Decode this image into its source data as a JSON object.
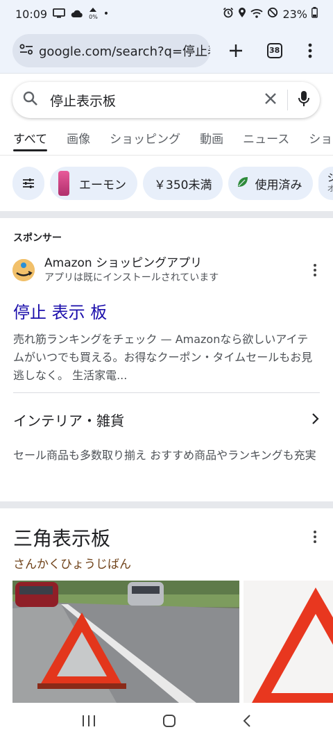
{
  "status": {
    "time": "10:09",
    "battery": "23%",
    "pct_small": "0%"
  },
  "url_bar": {
    "url": "google.com/search?q=停止表",
    "tab_count": "38"
  },
  "search": {
    "query": "停止表示板"
  },
  "tabs": [
    {
      "label": "すべて",
      "active": true
    },
    {
      "label": "画像"
    },
    {
      "label": "ショッピング"
    },
    {
      "label": "動画"
    },
    {
      "label": "ニュース"
    },
    {
      "label": "ショ"
    }
  ],
  "chips": [
    {
      "label": "エーモン"
    },
    {
      "label": "￥350未満"
    },
    {
      "label": "使用済み"
    },
    {
      "label": "シ",
      "sub": "オ"
    }
  ],
  "ad": {
    "sponsor_label": "スポンサー",
    "advertiser": "Amazon ショッピングアプリ",
    "advertiser_sub": "アプリは既にインストールされています",
    "title": "停止 表示 板",
    "description": "売れ筋ランキングをチェック — Amazonなら欲しいアイテムがいつでも買える。お得なクーポン・タイムセールもお見逃しなく。 生活家電...",
    "sitelink_title": "インテリア・雑貨",
    "sitelink_desc": "セール商品も多数取り揃え おすすめ商品やランキングも充実"
  },
  "knowledge": {
    "title": "三角表示板",
    "reading": "さんかくひょうじばん"
  },
  "colors": {
    "accent_link": "#1a0dab",
    "chip_bg": "#e8effa",
    "reading_brown": "#70431a"
  }
}
